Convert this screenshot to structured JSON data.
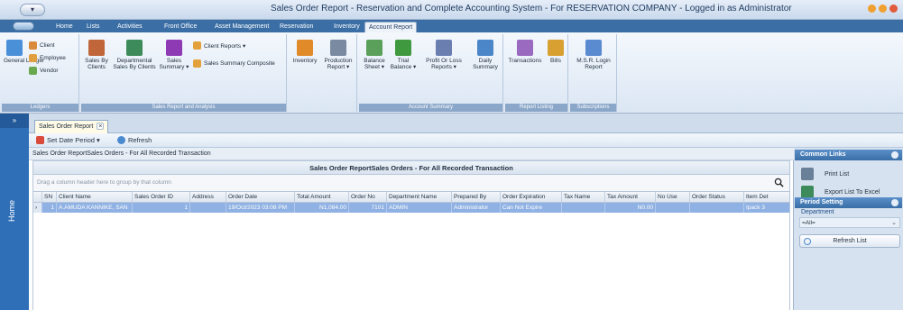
{
  "window": {
    "title": "Sales Order Report - Reservation and Complete Accounting System - For RESERVATION COMPANY - Logged in as Administrator"
  },
  "menu_tabs": [
    "Home",
    "Lists",
    "Activities",
    "Front Office",
    "Asset Management",
    "Reservation",
    "Inventory",
    "Account Report"
  ],
  "ribbon": {
    "ledgers": {
      "general_ledger": "General Ledger",
      "client": "Client",
      "employee": "Employee",
      "vendor": "Vendor",
      "group_label": "Ledgers"
    },
    "sales": {
      "sales_by_clients": "Sales By Clients",
      "departmental": "Departmental Sales By Clients",
      "sales_summary": "Sales Summary ▾",
      "client_reports": "Client Reports ▾",
      "sales_summary_composite": "Sales Summary Composite",
      "group_label": "Sales Report and Analysis"
    },
    "inventory": {
      "inventory": "Inventory",
      "production_report": "Production Report ▾"
    },
    "account_summary": {
      "balance_sheet": "Balance Sheet ▾",
      "trial_balance": "Trial Balance ▾",
      "profit_or_loss": "Profit Or Loss Reports ▾",
      "daily_summary": "Daily Summary",
      "group_label": "Account Summary"
    },
    "report_listing": {
      "transactions": "Transactions",
      "bills": "Bills",
      "group_label": "Report Listing"
    },
    "subscriptions": {
      "login_report": "M.S.R. Login Report",
      "group_label": "Subscriptions"
    }
  },
  "document_tab": {
    "label": "Sales Order Report",
    "close": "×"
  },
  "toolbar": {
    "set_date_period": "Set Date Period ▾",
    "refresh": "Refresh"
  },
  "caption": "Sales Order ReportSales Orders - For All Recorded Transaction",
  "grid": {
    "title": "Sales Order ReportSales Orders - For All Recorded Transaction",
    "group_hint": "Drag a column header here to group by that column",
    "columns": [
      "SN",
      "Client Name",
      "Sales Order ID",
      "Address",
      "Order Date",
      "Total Amount",
      "Order No",
      "Department Name",
      "Prepared By",
      "Order Expiration",
      "Tax Name",
      "Tax Amount",
      "No Use",
      "Order Status",
      "Item Det"
    ],
    "rows": [
      [
        "1",
        "A.AMUDA KANNIKE, SAN",
        "1",
        "",
        "19/Oct/2023 03:08 PM",
        "N1,084.00",
        "7101",
        "ADMIN",
        "Administrator",
        "Can Not Expire",
        "",
        "N0.00",
        "",
        "",
        "Ipack 3"
      ]
    ]
  },
  "left_rail": {
    "toggle": "»",
    "home": "Home"
  },
  "right_panel": {
    "common_links_title": "Common Links",
    "print_list": "Print List",
    "export_list": "Export List To Excel",
    "period_setting_title": "Period Setting",
    "department_label": "Department",
    "department_value": "=All=",
    "refresh_list": "Refresh List"
  }
}
